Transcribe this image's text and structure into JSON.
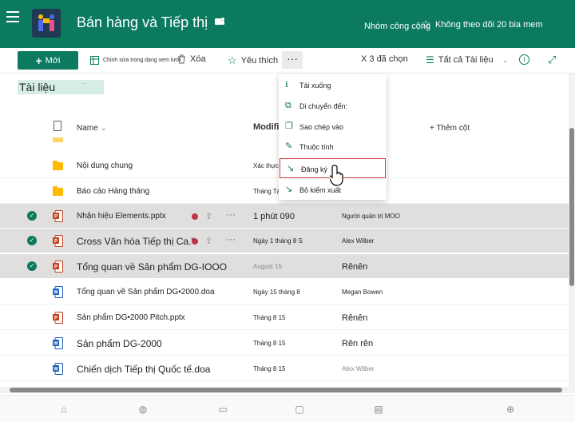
{
  "header": {
    "site_title": "Bán hàng và Tiếp thị",
    "group_label": "Nhóm công cộng",
    "follow_label": "Không theo dõi 20 bia mem"
  },
  "commandbar": {
    "new_label": "Mới",
    "grid_edit_label": "Chỉnh sửa trong dạng xem lưới",
    "delete_label": "Xóa",
    "favorite_label": "Yêu thích",
    "more_label": "···",
    "selected_label": "X 3 đã chọn",
    "all_docs_label": "Tất cả Tài liệu"
  },
  "library": {
    "title": "Tài liệu",
    "title_badge": "···"
  },
  "columns": {
    "name": "Name",
    "modified": "Modifie",
    "add": "+ Thêm cột"
  },
  "rows": [
    {
      "name": "Nội dung chung",
      "modified": "Xác thực",
      "by": "",
      "type": "folder",
      "selected": false
    },
    {
      "name": "Báo cáo Hàng tháng",
      "modified": "Tháng Tám",
      "by": "",
      "type": "folder",
      "selected": false
    },
    {
      "name": "Nhận hiệu Elements.pptx",
      "modified": "1 phút 090",
      "by": "Người quản trị MOO",
      "type": "pptx",
      "selected": true
    },
    {
      "name": "Cross Văn hóa Tiếp thị Ca.\"",
      "modified": "Ngày 1 tháng 8 S",
      "by": "Alex Wilber",
      "type": "pptx",
      "selected": true
    },
    {
      "name": "Tổng quan về Sản phẩm DG-IOOO",
      "modified": "August 15",
      "by": "Rênên",
      "type": "pptx",
      "selected": true
    },
    {
      "name": "Tổng quan về Sản phẩm DG•2000.doa",
      "modified": "Ngày 15 tháng 8",
      "by": "Megan Bowen",
      "type": "docx",
      "selected": false
    },
    {
      "name": "Sản phẩm DG•2000 Pitch.pptx",
      "modified": "Tháng 8 15",
      "by": "Rênên",
      "type": "pptx",
      "selected": false
    },
    {
      "name": "Sản phẩm DG-2000",
      "modified": "Tháng 8 15",
      "by": "Rên rên",
      "type": "docx",
      "selected": false
    },
    {
      "name": "Chiến dịch Tiếp thị Quốc tế.doa",
      "modified": "Tháng 8 15",
      "by": "Alex Wilber",
      "type": "docx",
      "selected": false
    }
  ],
  "menu": {
    "items": [
      {
        "label": "Tải xuống",
        "icon": "download-icon"
      },
      {
        "label": "Di chuyển đến:",
        "icon": "move-icon"
      },
      {
        "label": "Sao chép vào",
        "icon": "copy-icon"
      },
      {
        "label": "Thuộc tính",
        "icon": "edit-icon"
      },
      {
        "label": "Đăng ký",
        "icon": "check-in-icon"
      },
      {
        "label": "Bỏ kiểm xuất",
        "icon": "discard-checkout-icon"
      }
    ]
  },
  "colors": {
    "brand": "#0b7a5f",
    "highlight_border": "#d13438"
  }
}
